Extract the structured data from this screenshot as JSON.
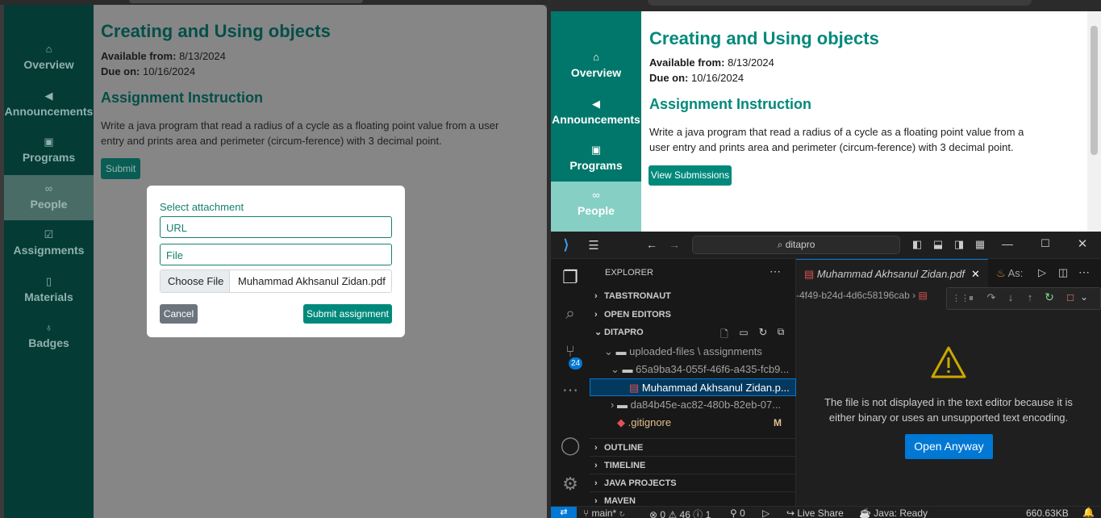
{
  "left_app": {
    "nav": [
      {
        "icon": "house-icon",
        "glyph": "⌂",
        "label": "Overview"
      },
      {
        "icon": "megaphone-icon",
        "glyph": "◀",
        "label": "Announcements"
      },
      {
        "icon": "book-icon",
        "glyph": "▣",
        "label": "Programs"
      },
      {
        "icon": "people-icon",
        "glyph": "∞",
        "label": "People"
      },
      {
        "icon": "clipboard-icon",
        "glyph": "☑",
        "label": "Assignments"
      },
      {
        "icon": "file-icon",
        "glyph": "▯",
        "label": "Materials"
      },
      {
        "icon": "award-icon",
        "glyph": "♁",
        "label": "Badges"
      }
    ],
    "title": "Creating and Using objects",
    "available_label": "Available from:",
    "available_value": "8/13/2024",
    "due_label": "Due on:",
    "due_value": "10/16/2024",
    "instruction_heading": "Assignment Instruction",
    "instruction_line1": "Write a java program that read a radius of a cycle as a floating point value from a user",
    "instruction_line2": "entry and prints area and perimeter (circum-ference) with 3 decimal point.",
    "submit_label": "Submit",
    "modal": {
      "label": "Select attachment",
      "url_placeholder": "URL",
      "file_placeholder": "File",
      "choose_file": "Choose File",
      "file_name": "Muhammad Akhsanul Zidan.pdf",
      "cancel": "Cancel",
      "submit_assignment": "Submit assignment"
    }
  },
  "right_app": {
    "nav": [
      {
        "label": "Overview"
      },
      {
        "label": "Announcements"
      },
      {
        "label": "Programs"
      },
      {
        "label": "People"
      }
    ],
    "title": "Creating and Using objects",
    "available_label": "Available from:",
    "available_value": "8/13/2024",
    "due_label": "Due on:",
    "due_value": "10/16/2024",
    "instruction_heading": "Assignment Instruction",
    "instruction_line1": "Write a java program that read a radius of a cycle as a floating point value from a",
    "instruction_line2": "user entry and prints area and perimeter (circum-ference) with 3 decimal point.",
    "view_submissions": "View Submissions"
  },
  "vscode": {
    "search_text": "ditapro",
    "explorer_title": "EXPLORER",
    "sections": {
      "tabstronaut": "TABSTRONAUT",
      "open_editors": "OPEN EDITORS",
      "ditapro": "DITAPRO",
      "outline": "OUTLINE",
      "timeline": "TIMELINE",
      "java_projects": "JAVA PROJECTS",
      "maven": "MAVEN"
    },
    "tree": {
      "folder1": "uploaded-files \\ assignments",
      "folder2": "65a9ba34-055f-46f6-a435-fcb9...",
      "file_selected": "Muhammad Akhsanul Zidan.p...",
      "folder3": "da84b45e-ac82-480b-82eb-07...",
      "gitignore": ".gitignore",
      "gitignore_status": "M"
    },
    "badge_count": "24",
    "tab_active": "Muhammad Akhsanul Zidan.pdf",
    "tab_second": "As:",
    "breadcrumb": "-4f49-b24d-4d6c58196cab",
    "message_line1": "The file is not displayed in the text editor because it is",
    "message_line2": "either binary or uses an unsupported text encoding.",
    "open_anyway": "Open Anyway",
    "status": {
      "branch": "main*",
      "errors": "0",
      "warnings": "46",
      "info": "1",
      "ports": "0",
      "live_share": "Live Share",
      "java": "Java: Ready",
      "size": "660.63KB"
    }
  }
}
